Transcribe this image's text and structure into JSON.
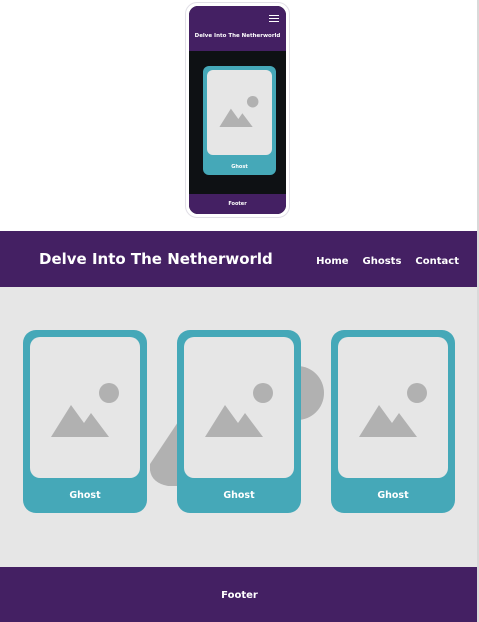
{
  "site": {
    "title": "Delve Into The Netherworld",
    "nav": [
      "Home",
      "Ghosts",
      "Contact"
    ],
    "footer": "Footer"
  },
  "cards": [
    {
      "label": "Ghost",
      "icon": "image-placeholder-icon"
    },
    {
      "label": "Ghost",
      "icon": "image-placeholder-icon"
    },
    {
      "label": "Ghost",
      "icon": "image-placeholder-icon"
    }
  ],
  "mobile_preview": {
    "title": "Delve Into The Netherworld",
    "menu_icon": "hamburger-menu-icon",
    "card_label": "Ghost",
    "footer": "Footer"
  },
  "colors": {
    "header": "#442063",
    "card": "#45a8b8",
    "content_bg": "#e6e6e6",
    "placeholder_gray": "#b1b1b1",
    "mobile_bg": "#0e1114"
  }
}
